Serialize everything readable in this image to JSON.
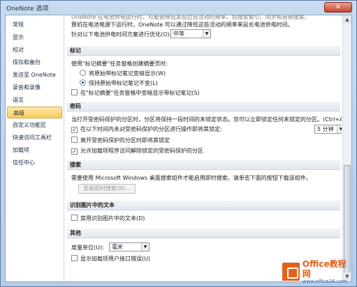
{
  "window": {
    "title": "OneNote 选项",
    "close_glyph": "✕"
  },
  "sidebar": {
    "items": [
      {
        "label": "常规"
      },
      {
        "label": "显示"
      },
      {
        "label": "校对"
      },
      {
        "label": "保存和备份"
      },
      {
        "label": "发送至 OneNote"
      },
      {
        "label": "录音和录像"
      },
      {
        "label": "语言"
      },
      {
        "label": "高级"
      },
      {
        "label": "自定义功能区"
      },
      {
        "label": "快速访问工具栏"
      },
      {
        "label": "加载项"
      },
      {
        "label": "信任中心"
      }
    ],
    "active_index": 7
  },
  "battery": {
    "faded_text": "OneNote 在电池供电运行时，可能会降低某些后台活动的频率，如搜索索引、同步和音频搜索。",
    "line2": "算机在电池电源下运行时，OneNote 可以通过降低这些活动的频率来延长电池供电时间。",
    "opt_label": "针对以下电池供电时间方案进行优化(O):",
    "opt_value": "中等"
  },
  "tags": {
    "header": "标记",
    "desc": "使用\"标记摘要\"任务窗格创建摘要页时:",
    "radio1": "将原始带标记笔记变暗显示(W)",
    "radio2": "保持原始带标记笔记不变(L)",
    "check1": "在\"标记摘要\"任务窗格中变暗显示带标记笔记(S)"
  },
  "password": {
    "header": "密码",
    "desc": "当打开受密码保护的分区时，分区将保持一段时间的未锁定状态。您可以立即锁定任何未锁定的分区。(Ctrl+Alt+L)",
    "check1": "在以下时间内未对受密码保护的分区进行操作即将其锁定:",
    "time_value": "5 分钟",
    "check2": "离开受密码保护的分区时即将其锁定",
    "check3": "允许加载项程序访问解除锁定的受密码保护的分区"
  },
  "search": {
    "header": "搜索",
    "desc": "需要使用 Microsoft Windows 桌面搜索组件才能启用即时搜索。请单击下面的按钮下载该组件。",
    "button": "安装即时搜索(N)..."
  },
  "ocr": {
    "header": "识别图片中的文本",
    "check1": "禁用识别图片中的文本(D)"
  },
  "other": {
    "header": "其他",
    "unit_label": "度量单位(U):",
    "unit_value": "毫米",
    "check1": "显示加载项用户接口错误(U)"
  },
  "watermark": {
    "name": "Office教程网",
    "url": "www.office26.com"
  }
}
